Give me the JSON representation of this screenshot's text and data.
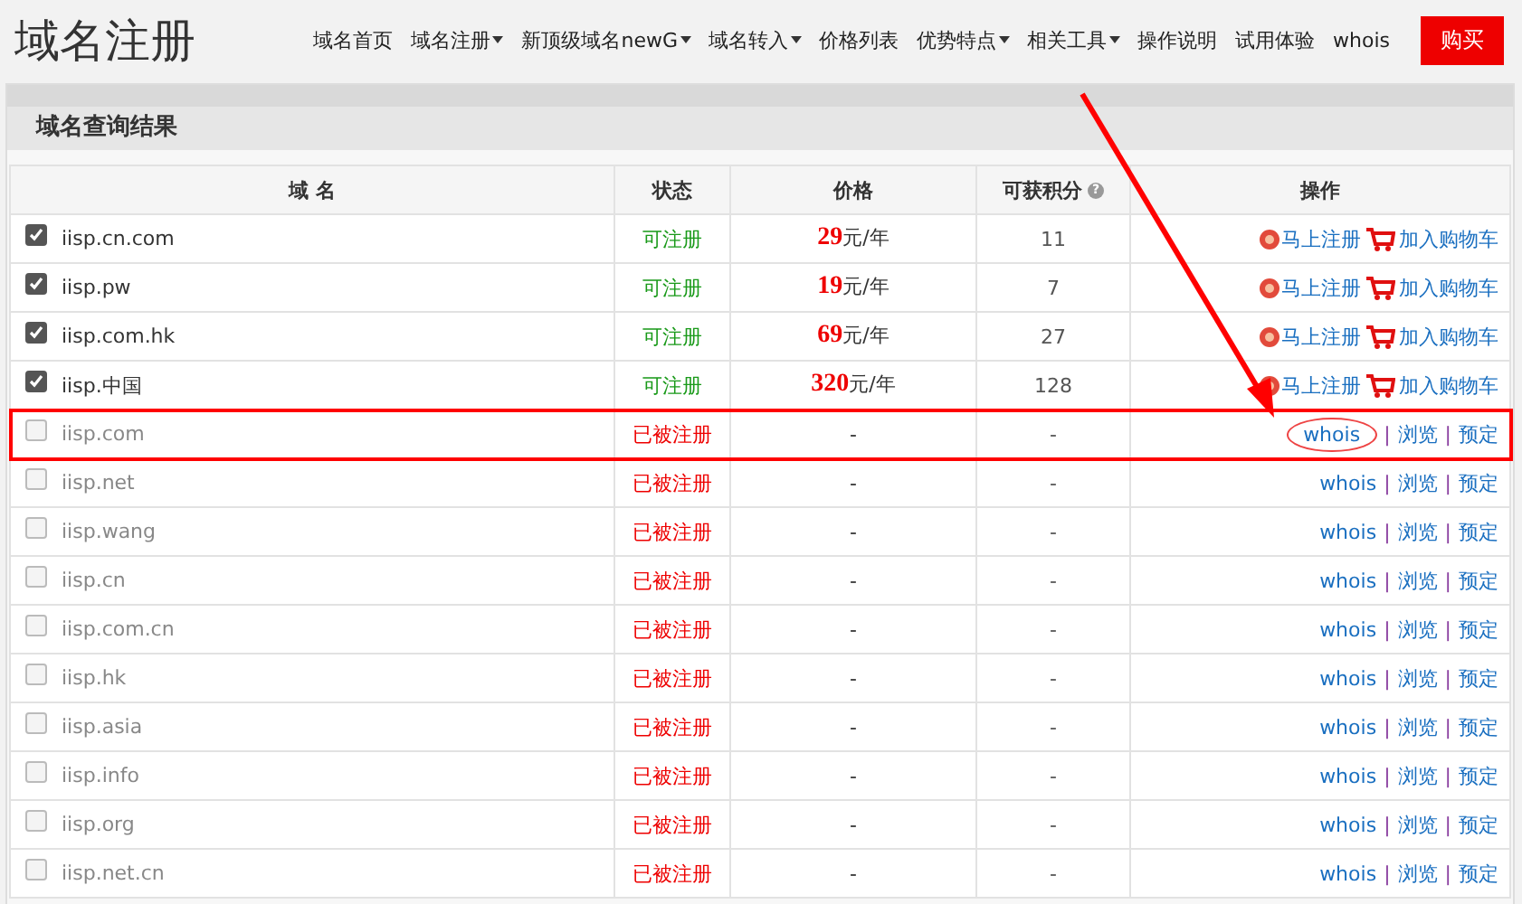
{
  "header": {
    "logo": "域名注册",
    "nav": [
      {
        "label": "域名首页",
        "dropdown": false
      },
      {
        "label": "域名注册",
        "dropdown": true
      },
      {
        "label": "新顶级域名newG",
        "dropdown": true
      },
      {
        "label": "域名转入",
        "dropdown": true
      },
      {
        "label": "价格列表",
        "dropdown": false
      },
      {
        "label": "优势特点",
        "dropdown": true
      },
      {
        "label": "相关工具",
        "dropdown": true
      },
      {
        "label": "操作说明",
        "dropdown": false
      },
      {
        "label": "试用体验",
        "dropdown": false
      },
      {
        "label": "whois",
        "dropdown": false
      }
    ],
    "buy_button": "购买"
  },
  "panel": {
    "title": "域名查询结果",
    "table": {
      "columns": [
        {
          "label": "域 名"
        },
        {
          "label": "状态"
        },
        {
          "label": "价格"
        },
        {
          "label": "可获积分",
          "help_icon": "?"
        },
        {
          "label": "操作"
        }
      ],
      "rows": [
        {
          "kind": "available",
          "checked": true,
          "domain": "iisp.cn.com",
          "status": "可注册",
          "price": "**29**元/年",
          "points": "11",
          "actions": [
            "马上注册",
            "加入购物车"
          ],
          "highlighted": false
        },
        {
          "kind": "available",
          "checked": true,
          "domain": "iisp.pw",
          "status": "可注册",
          "price": "**19**元/年",
          "points": "7",
          "actions": [
            "马上注册",
            "加入购物车"
          ],
          "highlighted": false
        },
        {
          "kind": "available",
          "checked": true,
          "domain": "iisp.com.hk",
          "status": "可注册",
          "price": "**69**元/年",
          "points": "27",
          "actions": [
            "马上注册",
            "加入购物车"
          ],
          "highlighted": false
        },
        {
          "kind": "available",
          "checked": true,
          "domain": "iisp.中国",
          "status": "可注册",
          "price": "**320**元/年",
          "points": "128",
          "actions": [
            "马上注册",
            "加入购物车"
          ],
          "highlighted": false
        },
        {
          "kind": "taken",
          "checked": false,
          "domain": "iisp.com",
          "status": "已被注册",
          "price": "-",
          "points": "-",
          "actions": [
            "whois",
            "浏览",
            "预定"
          ],
          "separator": "|",
          "highlighted": true
        },
        {
          "kind": "taken",
          "checked": false,
          "domain": "iisp.net",
          "status": "已被注册",
          "price": "-",
          "points": "-",
          "actions": [
            "whois",
            "浏览",
            "预定"
          ],
          "separator": "|",
          "highlighted": false
        },
        {
          "kind": "taken",
          "checked": false,
          "domain": "iisp.wang",
          "status": "已被注册",
          "price": "-",
          "points": "-",
          "actions": [
            "whois",
            "浏览",
            "预定"
          ],
          "separator": "|",
          "highlighted": false
        },
        {
          "kind": "taken",
          "checked": false,
          "domain": "iisp.cn",
          "status": "已被注册",
          "price": "-",
          "points": "-",
          "actions": [
            "whois",
            "浏览",
            "预定"
          ],
          "separator": "|",
          "highlighted": false
        },
        {
          "kind": "taken",
          "checked": false,
          "domain": "iisp.com.cn",
          "status": "已被注册",
          "price": "-",
          "points": "-",
          "actions": [
            "whois",
            "浏览",
            "预定"
          ],
          "separator": "|",
          "highlighted": false
        },
        {
          "kind": "taken",
          "checked": false,
          "domain": "iisp.hk",
          "status": "已被注册",
          "price": "-",
          "points": "-",
          "actions": [
            "whois",
            "浏览",
            "预定"
          ],
          "separator": "|",
          "highlighted": false
        },
        {
          "kind": "taken",
          "checked": false,
          "domain": "iisp.asia",
          "status": "已被注册",
          "price": "-",
          "points": "-",
          "actions": [
            "whois",
            "浏览",
            "预定"
          ],
          "separator": "|",
          "highlighted": false
        },
        {
          "kind": "taken",
          "checked": false,
          "domain": "iisp.info",
          "status": "已被注册",
          "price": "-",
          "points": "-",
          "actions": [
            "whois",
            "浏览",
            "预定"
          ],
          "separator": "|",
          "highlighted": false
        },
        {
          "kind": "taken",
          "checked": false,
          "domain": "iisp.org",
          "status": "已被注册",
          "price": "-",
          "points": "-",
          "actions": [
            "whois",
            "浏览",
            "预定"
          ],
          "separator": "|",
          "highlighted": false
        },
        {
          "kind": "taken",
          "checked": false,
          "domain": "iisp.net.cn",
          "status": "已被注册",
          "price": "-",
          "points": "-",
          "actions": [
            "whois",
            "浏览",
            "预定"
          ],
          "separator": "|",
          "highlighted": false
        }
      ]
    }
  }
}
